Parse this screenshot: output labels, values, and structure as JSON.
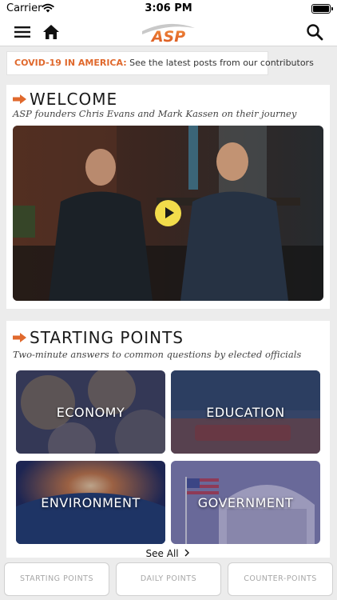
{
  "status_bar": {
    "carrier": "Carrier",
    "time": "3:06 PM"
  },
  "nav": {
    "logo_text": "ASP",
    "icons": [
      "menu-icon",
      "home-icon",
      "search-icon"
    ]
  },
  "banner": {
    "highlight": "COVID-19 IN AMERICA:",
    "text": "See the latest posts from our contributors"
  },
  "welcome": {
    "title": "WELCOME",
    "subtitle": "ASP founders Chris Evans and Mark Kassen on their journey",
    "video_icon": "play-icon"
  },
  "starting_points": {
    "title": "STARTING POINTS",
    "subtitle": "Two-minute answers to common questions by elected officials",
    "tiles": [
      {
        "label": "ECONOMY"
      },
      {
        "label": "EDUCATION"
      },
      {
        "label": "ENVIRONMENT"
      },
      {
        "label": "GOVERNMENT"
      }
    ],
    "see_all": "See All"
  },
  "tabs": [
    {
      "label": "STARTING POINTS"
    },
    {
      "label": "DAILY POINTS"
    },
    {
      "label": "COUNTER-POINTS"
    }
  ],
  "colors": {
    "accent": "#e0692d",
    "play_button": "#f2dc4b",
    "tab_text": "#a7a7a7"
  }
}
